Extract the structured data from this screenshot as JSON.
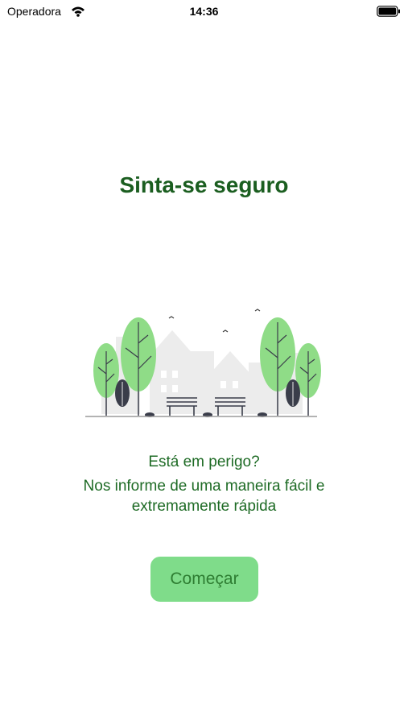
{
  "status_bar": {
    "carrier": "Operadora",
    "time": "14:36",
    "wifi_icon": "wifi-icon",
    "battery_icon": "battery-icon"
  },
  "main": {
    "title": "Sinta-se seguro",
    "illustration": "city-park-illustration",
    "question": "Está em perigo?",
    "description": "Nos informe de uma maneira fácil e extremamente rápida",
    "start_button_label": "Começar"
  },
  "colors": {
    "title": "#1b5e20",
    "text": "#1e6b25",
    "button_bg": "#7fdc8a",
    "button_text": "#2e7d32",
    "tree_green": "#8fdc87",
    "bush_dark": "#3a3d4a"
  }
}
